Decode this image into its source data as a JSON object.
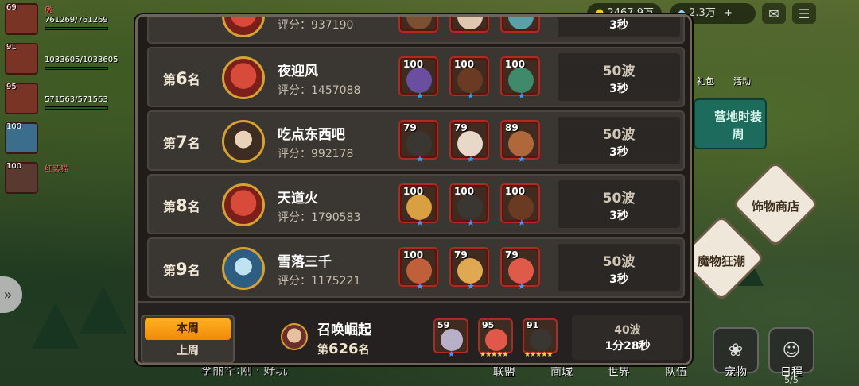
{
  "topbar": {
    "resources": [
      "2467.9万",
      "2.3万"
    ],
    "plus_icon": "plus-icon",
    "mail_icon": "mail-icon",
    "menu_icon": "menu-icon"
  },
  "side_team": [
    {
      "level": "69",
      "name": "傲",
      "hp": "761269/761269"
    },
    {
      "level": "91",
      "name": "",
      "hp": "1033605/1033605"
    },
    {
      "level": "95",
      "name": "",
      "hp": "571563/571563"
    },
    {
      "level": "100",
      "name": "",
      "hp": ""
    },
    {
      "level": "100",
      "name": "红装猫",
      "hp": ""
    }
  ],
  "right_side": {
    "labels": [
      "礼包",
      "活动"
    ],
    "camp_banner": "营地时装周",
    "accessory_shop": "饰物商店",
    "monster_frenzy": "魔物狂潮"
  },
  "bottom_bar": {
    "chat_text": "李丽华:刚 · 好玩",
    "nav": [
      "联盟",
      "商城",
      "世界",
      "队伍"
    ],
    "pet": "宠物",
    "schedule": "日程",
    "schedule_count": "5/5"
  },
  "leaderboard": {
    "rank_prefix": "第",
    "rank_suffix": "名",
    "score_prefix": "评分：",
    "partial_top": {
      "score": "937190",
      "time": "3秒"
    },
    "rows": [
      {
        "rank": "6",
        "name": "夜迎风",
        "score": "1457088",
        "waves": "50波",
        "time": "3秒",
        "heroes": [
          {
            "level": "100"
          },
          {
            "level": "100"
          },
          {
            "level": "100"
          }
        ]
      },
      {
        "rank": "7",
        "name": "吃点东西吧",
        "score": "992178",
        "waves": "50波",
        "time": "3秒",
        "heroes": [
          {
            "level": "79"
          },
          {
            "level": "79"
          },
          {
            "level": "89"
          }
        ]
      },
      {
        "rank": "8",
        "name": "天道火",
        "score": "1790583",
        "waves": "50波",
        "time": "3秒",
        "heroes": [
          {
            "level": "100"
          },
          {
            "level": "100"
          },
          {
            "level": "100"
          }
        ]
      },
      {
        "rank": "9",
        "name": "雪落三千",
        "score": "1175221",
        "waves": "50波",
        "time": "3秒",
        "heroes": [
          {
            "level": "100"
          },
          {
            "level": "79"
          },
          {
            "level": "79"
          }
        ]
      }
    ],
    "tabs": {
      "this_week": "本周",
      "last_week": "上周"
    },
    "own": {
      "name": "召唤崛起",
      "rank": "626",
      "waves": "40波",
      "time": "1分28秒",
      "heroes": [
        {
          "level": "59"
        },
        {
          "level": "95"
        },
        {
          "level": "91"
        }
      ]
    }
  }
}
